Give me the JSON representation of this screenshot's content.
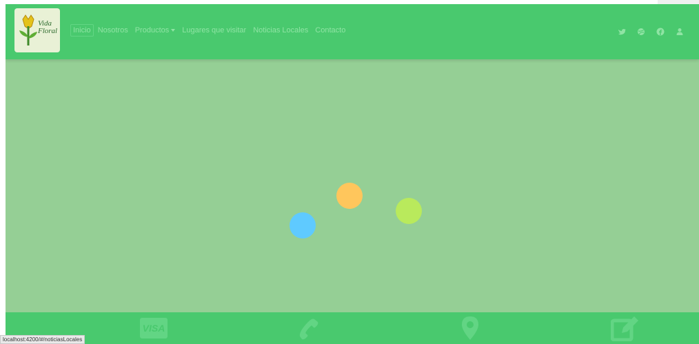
{
  "brand": {
    "logo_line1": "Vida",
    "logo_line2": "Floral"
  },
  "nav": {
    "items": [
      {
        "label": "Inicio",
        "active": true
      },
      {
        "label": "Nosotros"
      },
      {
        "label": "Productos",
        "dropdown": true
      },
      {
        "label": "Lugares que visitar"
      },
      {
        "label": "Noticias Locales"
      },
      {
        "label": "Contacto"
      }
    ]
  },
  "social_icons": [
    "twitter-icon",
    "dribbble-icon",
    "facebook-icon",
    "user-icon"
  ],
  "loader": {
    "dots": [
      {
        "color": "#ffc65c"
      },
      {
        "color": "#b9ea5c"
      },
      {
        "color": "#5fcaff"
      }
    ]
  },
  "footer": {
    "visa_label": "VISA",
    "icons": [
      "visa-icon",
      "phone-icon",
      "map-marker-icon",
      "edit-icon"
    ]
  },
  "status_bar": {
    "url": "localhost:4200/#/noticiasLocales"
  },
  "colors": {
    "header": "#49c96e",
    "overlay": "#95cf95",
    "footer": "#49c96e"
  }
}
